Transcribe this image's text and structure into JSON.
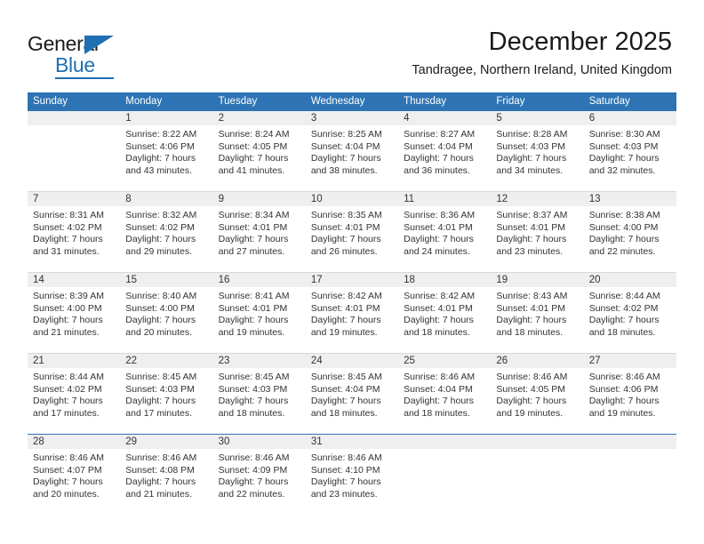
{
  "brand": {
    "name_part1": "General",
    "name_part2": "Blue",
    "accent_color": "#1f6fb2"
  },
  "header": {
    "title": "December 2025",
    "subtitle": "Tandragee, Northern Ireland, United Kingdom"
  },
  "calendar": {
    "header_color": "#2e74b5",
    "weekdays": [
      "Sunday",
      "Monday",
      "Tuesday",
      "Wednesday",
      "Thursday",
      "Friday",
      "Saturday"
    ],
    "weeks": [
      [
        {
          "day": "",
          "lines": [
            "",
            "",
            "",
            ""
          ],
          "empty": true
        },
        {
          "day": "1",
          "lines": [
            "Sunrise: 8:22 AM",
            "Sunset: 4:06 PM",
            "Daylight: 7 hours",
            "and 43 minutes."
          ]
        },
        {
          "day": "2",
          "lines": [
            "Sunrise: 8:24 AM",
            "Sunset: 4:05 PM",
            "Daylight: 7 hours",
            "and 41 minutes."
          ]
        },
        {
          "day": "3",
          "lines": [
            "Sunrise: 8:25 AM",
            "Sunset: 4:04 PM",
            "Daylight: 7 hours",
            "and 38 minutes."
          ]
        },
        {
          "day": "4",
          "lines": [
            "Sunrise: 8:27 AM",
            "Sunset: 4:04 PM",
            "Daylight: 7 hours",
            "and 36 minutes."
          ]
        },
        {
          "day": "5",
          "lines": [
            "Sunrise: 8:28 AM",
            "Sunset: 4:03 PM",
            "Daylight: 7 hours",
            "and 34 minutes."
          ]
        },
        {
          "day": "6",
          "lines": [
            "Sunrise: 8:30 AM",
            "Sunset: 4:03 PM",
            "Daylight: 7 hours",
            "and 32 minutes."
          ]
        }
      ],
      [
        {
          "day": "7",
          "lines": [
            "Sunrise: 8:31 AM",
            "Sunset: 4:02 PM",
            "Daylight: 7 hours",
            "and 31 minutes."
          ]
        },
        {
          "day": "8",
          "lines": [
            "Sunrise: 8:32 AM",
            "Sunset: 4:02 PM",
            "Daylight: 7 hours",
            "and 29 minutes."
          ]
        },
        {
          "day": "9",
          "lines": [
            "Sunrise: 8:34 AM",
            "Sunset: 4:01 PM",
            "Daylight: 7 hours",
            "and 27 minutes."
          ]
        },
        {
          "day": "10",
          "lines": [
            "Sunrise: 8:35 AM",
            "Sunset: 4:01 PM",
            "Daylight: 7 hours",
            "and 26 minutes."
          ]
        },
        {
          "day": "11",
          "lines": [
            "Sunrise: 8:36 AM",
            "Sunset: 4:01 PM",
            "Daylight: 7 hours",
            "and 24 minutes."
          ]
        },
        {
          "day": "12",
          "lines": [
            "Sunrise: 8:37 AM",
            "Sunset: 4:01 PM",
            "Daylight: 7 hours",
            "and 23 minutes."
          ]
        },
        {
          "day": "13",
          "lines": [
            "Sunrise: 8:38 AM",
            "Sunset: 4:00 PM",
            "Daylight: 7 hours",
            "and 22 minutes."
          ]
        }
      ],
      [
        {
          "day": "14",
          "lines": [
            "Sunrise: 8:39 AM",
            "Sunset: 4:00 PM",
            "Daylight: 7 hours",
            "and 21 minutes."
          ]
        },
        {
          "day": "15",
          "lines": [
            "Sunrise: 8:40 AM",
            "Sunset: 4:00 PM",
            "Daylight: 7 hours",
            "and 20 minutes."
          ]
        },
        {
          "day": "16",
          "lines": [
            "Sunrise: 8:41 AM",
            "Sunset: 4:01 PM",
            "Daylight: 7 hours",
            "and 19 minutes."
          ]
        },
        {
          "day": "17",
          "lines": [
            "Sunrise: 8:42 AM",
            "Sunset: 4:01 PM",
            "Daylight: 7 hours",
            "and 19 minutes."
          ]
        },
        {
          "day": "18",
          "lines": [
            "Sunrise: 8:42 AM",
            "Sunset: 4:01 PM",
            "Daylight: 7 hours",
            "and 18 minutes."
          ]
        },
        {
          "day": "19",
          "lines": [
            "Sunrise: 8:43 AM",
            "Sunset: 4:01 PM",
            "Daylight: 7 hours",
            "and 18 minutes."
          ]
        },
        {
          "day": "20",
          "lines": [
            "Sunrise: 8:44 AM",
            "Sunset: 4:02 PM",
            "Daylight: 7 hours",
            "and 18 minutes."
          ]
        }
      ],
      [
        {
          "day": "21",
          "lines": [
            "Sunrise: 8:44 AM",
            "Sunset: 4:02 PM",
            "Daylight: 7 hours",
            "and 17 minutes."
          ]
        },
        {
          "day": "22",
          "lines": [
            "Sunrise: 8:45 AM",
            "Sunset: 4:03 PM",
            "Daylight: 7 hours",
            "and 17 minutes."
          ]
        },
        {
          "day": "23",
          "lines": [
            "Sunrise: 8:45 AM",
            "Sunset: 4:03 PM",
            "Daylight: 7 hours",
            "and 18 minutes."
          ]
        },
        {
          "day": "24",
          "lines": [
            "Sunrise: 8:45 AM",
            "Sunset: 4:04 PM",
            "Daylight: 7 hours",
            "and 18 minutes."
          ]
        },
        {
          "day": "25",
          "lines": [
            "Sunrise: 8:46 AM",
            "Sunset: 4:04 PM",
            "Daylight: 7 hours",
            "and 18 minutes."
          ]
        },
        {
          "day": "26",
          "lines": [
            "Sunrise: 8:46 AM",
            "Sunset: 4:05 PM",
            "Daylight: 7 hours",
            "and 19 minutes."
          ]
        },
        {
          "day": "27",
          "lines": [
            "Sunrise: 8:46 AM",
            "Sunset: 4:06 PM",
            "Daylight: 7 hours",
            "and 19 minutes."
          ]
        }
      ],
      [
        {
          "day": "28",
          "lines": [
            "Sunrise: 8:46 AM",
            "Sunset: 4:07 PM",
            "Daylight: 7 hours",
            "and 20 minutes."
          ]
        },
        {
          "day": "29",
          "lines": [
            "Sunrise: 8:46 AM",
            "Sunset: 4:08 PM",
            "Daylight: 7 hours",
            "and 21 minutes."
          ]
        },
        {
          "day": "30",
          "lines": [
            "Sunrise: 8:46 AM",
            "Sunset: 4:09 PM",
            "Daylight: 7 hours",
            "and 22 minutes."
          ]
        },
        {
          "day": "31",
          "lines": [
            "Sunrise: 8:46 AM",
            "Sunset: 4:10 PM",
            "Daylight: 7 hours",
            "and 23 minutes."
          ]
        },
        {
          "day": "",
          "lines": [
            "",
            "",
            "",
            ""
          ],
          "empty": true
        },
        {
          "day": "",
          "lines": [
            "",
            "",
            "",
            ""
          ],
          "empty": true
        },
        {
          "day": "",
          "lines": [
            "",
            "",
            "",
            ""
          ],
          "empty": true
        }
      ]
    ]
  }
}
